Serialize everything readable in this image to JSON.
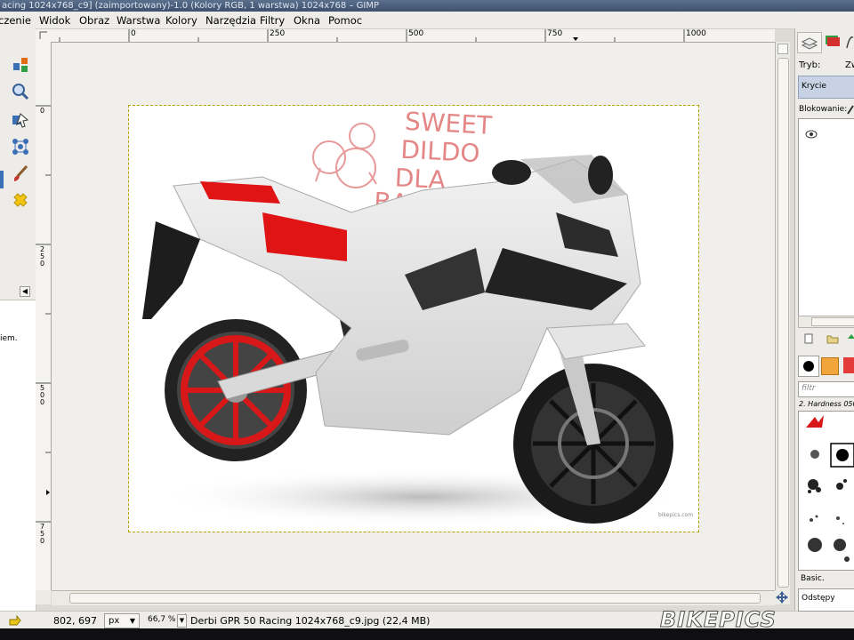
{
  "window": {
    "title": "acing 1024x768_c9] (zaimportowany)-1.0 (Kolory RGB, 1 warstwa) 1024x768 – GIMP"
  },
  "menu": {
    "items": [
      "czenie",
      "Widok",
      "Obraz",
      "Warstwa",
      "Kolory",
      "Narzędzia",
      "Filtry",
      "Okna",
      "Pomoc"
    ]
  },
  "toolbox": {
    "tools": [
      "align-icon",
      "zoom-icon",
      "transform-icon",
      "cage-icon",
      "paintbrush-icon",
      "heal-icon"
    ],
    "panel_text": "iem."
  },
  "rulers": {
    "top_ticks": [
      "0",
      "250",
      "500",
      "750",
      "1000"
    ],
    "left_ticks": [
      "0",
      "2\n5\n0",
      "5\n0\n0",
      "7\n5\n0"
    ]
  },
  "canvas": {
    "image_text_lines": [
      "SWEET",
      "DILDO",
      "DLA",
      "BARTKA"
    ],
    "watermark": "bikepics.com",
    "accent_red": "#e01414"
  },
  "statusbar": {
    "coords": "802, 697",
    "unit": "px",
    "zoom": "66,7 %",
    "file_info": "Derbi GPR 50 Racing 1024x768_c9.jpg (22,4 MB)"
  },
  "dock": {
    "mode_label": "Tryb:",
    "mode_value_partial": "Zw",
    "opacity_label": "Krycie",
    "lock_label": "Blokowanie:",
    "brush_filter_placeholder": "filtr",
    "brush_name": "2. Hardness 050",
    "brush_set": "Basic.",
    "spacing_label": "Odstępy"
  },
  "overlay": {
    "logo_text": "BIKEPICS"
  }
}
